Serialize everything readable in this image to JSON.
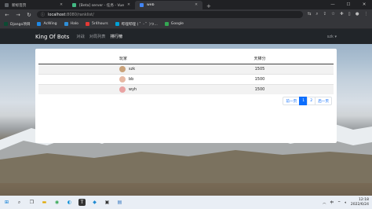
{
  "browser": {
    "tabs": [
      {
        "title": "新标签页",
        "color": "#5f6368",
        "active": false
      },
      {
        "title": "[Beta] server - 任务 - Vue CLI",
        "color": "#42b883",
        "active": false
      },
      {
        "title": "web",
        "color": "#4285f4",
        "active": true
      }
    ],
    "new_tab": "+",
    "url_host": "localhost",
    "url_path": ":8080/ranklist/",
    "bookmarks": [
      {
        "label": "Django项目",
        "color": "#0c4b33"
      },
      {
        "label": "AcWing",
        "color": "#1e88e5"
      },
      {
        "label": "Halo",
        "color": "#2f8fd8"
      },
      {
        "label": "5r4hours",
        "color": "#e53935"
      },
      {
        "label": "哔哩哔哩 ( ゜- ゜)つ...",
        "color": "#00a1d6"
      },
      {
        "label": "Google",
        "color": "#34a853"
      }
    ]
  },
  "app": {
    "brand": "King Of Bots",
    "nav": [
      {
        "label": "对战",
        "active": false
      },
      {
        "label": "对局列表",
        "active": false
      },
      {
        "label": "排行榜",
        "active": true
      }
    ],
    "user": "szk ▾"
  },
  "ranklist": {
    "headers": {
      "player": "玩家",
      "rating": "天梯分"
    },
    "rows": [
      {
        "name": "szk",
        "rating": "1505",
        "avatar_color": "#c9a27a"
      },
      {
        "name": "bb",
        "rating": "1500",
        "avatar_color": "#e7b9a4"
      },
      {
        "name": "wyh",
        "rating": "1500",
        "avatar_color": "#e9a3a3"
      }
    ]
  },
  "pagination": {
    "prev": "前一页",
    "pages": [
      "1",
      "2"
    ],
    "active_page": "1",
    "next": "后一页"
  },
  "taskbar": {
    "time": "12:18",
    "date": "2022/6/24",
    "lang": "中"
  }
}
